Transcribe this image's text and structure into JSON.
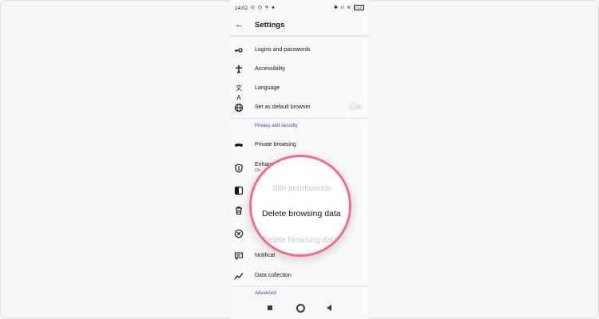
{
  "status_bar": {
    "time": "14:02",
    "left_icons": "⊙ ◷ ✈ ●",
    "right_icons": "✱ ıl ≋",
    "battery": "100"
  },
  "toolbar": {
    "title": "Settings",
    "back_icon": "arrow-left-icon"
  },
  "settings": {
    "items": [
      {
        "label": "Logins and passwords",
        "icon": "key-icon"
      },
      {
        "label": "Accessibility",
        "icon": "accessibility-icon"
      },
      {
        "label": "Language",
        "icon": "translate-icon"
      },
      {
        "label": "Set as default browser",
        "icon": "globe-icon",
        "toggle": false
      }
    ],
    "privacy_section": "Privacy and security",
    "privacy_items": [
      {
        "label": "Private browsing",
        "icon": "mask-icon"
      },
      {
        "label": "Enhance",
        "sub": "On",
        "icon": "shield-icon"
      },
      {
        "label": "",
        "icon": "site-permissions-icon"
      },
      {
        "label": "",
        "icon": "trash-icon"
      },
      {
        "label": "",
        "icon": "close-circle-icon"
      },
      {
        "label": "Notificat",
        "icon": "notification-icon"
      },
      {
        "label": "Data collection",
        "icon": "chart-line-icon"
      }
    ],
    "advanced_section": "Advanced"
  },
  "magnifier": {
    "top_text": "Site permissions",
    "main_text": "Delete browsing data",
    "bottom_text": "Delete browsing data"
  },
  "colors": {
    "accent": "#592acb",
    "magnifier_border": "#f56c83",
    "text": "#15141a"
  }
}
